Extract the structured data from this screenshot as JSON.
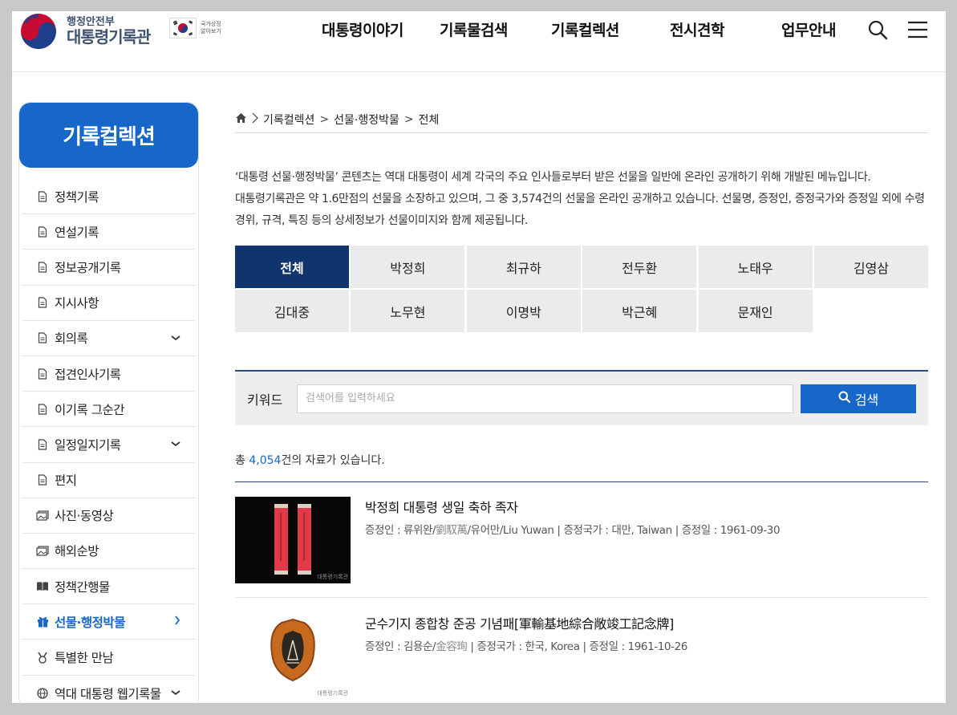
{
  "header": {
    "logo_top": "행정안전부",
    "logo_main": "대통령기록관",
    "flag_text": "국가상징 알아보기",
    "nav": [
      "대통령이야기",
      "기록물검색",
      "기록컬렉션",
      "전시견학",
      "업무안내"
    ]
  },
  "sidebar": {
    "title": "기록컬렉션",
    "items": [
      {
        "label": "정책기록",
        "icon": "document-icon",
        "has_sub": false
      },
      {
        "label": "연설기록",
        "icon": "document-icon",
        "has_sub": false
      },
      {
        "label": "정보공개기록",
        "icon": "document-icon",
        "has_sub": false
      },
      {
        "label": "지시사항",
        "icon": "document-icon",
        "has_sub": false
      },
      {
        "label": "회의록",
        "icon": "document-icon",
        "has_sub": true
      },
      {
        "label": "접견인사기록",
        "icon": "document-icon",
        "has_sub": false
      },
      {
        "label": "이기록 그순간",
        "icon": "document-icon",
        "has_sub": false
      },
      {
        "label": "일정일지기록",
        "icon": "document-icon",
        "has_sub": true
      },
      {
        "label": "편지",
        "icon": "document-icon",
        "has_sub": false
      },
      {
        "label": "사진·동영상",
        "icon": "photo-icon",
        "has_sub": false
      },
      {
        "label": "해외순방",
        "icon": "photo-icon",
        "has_sub": false
      },
      {
        "label": "정책간행물",
        "icon": "book-icon",
        "has_sub": false
      },
      {
        "label": "선물·행정박물",
        "icon": "gift-icon",
        "has_sub": true,
        "active": true
      },
      {
        "label": "특별한 만남",
        "icon": "medal-icon",
        "has_sub": false
      },
      {
        "label": "역대 대통령 웹기록물",
        "icon": "globe-icon",
        "has_sub": true
      }
    ]
  },
  "breadcrumb": [
    "기록컬렉션",
    "선물·행정박물",
    "전체"
  ],
  "breadcrumb_sep": ">",
  "intro": "‘대통령 선물·행정박물’ 콘텐츠는 역대 대통령이 세계 각국의 주요 인사들로부터 받은 선물을 일반에 온라인 공개하기 위해 개발된 메뉴입니다. 대통령기록관은 약 1.6만점의 선물을 소장하고 있으며, 그 중 3,574건의 선물을 온라인 공개하고 있습니다. 선물명, 증정인, 증정국가와 증정일 외에 수령 경위, 규격, 특징 등의 상세정보가 선물이미지와 함께 제공됩니다.",
  "tabs": [
    "전체",
    "박정희",
    "최규하",
    "전두환",
    "노태우",
    "김영삼",
    "김대중",
    "노무현",
    "이명박",
    "박근혜",
    "문재인"
  ],
  "search": {
    "label": "키워드",
    "placeholder": "검색어를 입력하세요",
    "button": "검색"
  },
  "result": {
    "prefix": "총 ",
    "count": "4,054",
    "suffix": "건의 자료가 있습니다."
  },
  "items": [
    {
      "title": "박정희 대통령 생일 축하 족자",
      "donor_label": "증정인 : ",
      "donor": "류위완/",
      "donor_hanja": "劉馭萬",
      "donor_rest": "/유어만/Liu Yuwan",
      "country_label": " | 증정국가 : ",
      "country": "대만, Taiwan",
      "date_label": " | 증정일 : ",
      "date": "1961-09-30",
      "watermark": "대통령기록관"
    },
    {
      "title": "군수기지 종합창 준공 기념패[軍輸基地綜合敞竣工記念牌]",
      "donor_label": "증정인 : ",
      "donor": "김용순/",
      "donor_hanja": "金容珣",
      "donor_rest": "",
      "country_label": " | 증정국가 : ",
      "country": "한국, Korea",
      "date_label": " | 증정일 : ",
      "date": "1961-10-26",
      "watermark": "대통령기록관"
    }
  ],
  "colors": {
    "primary": "#1667c9",
    "tab_active": "#10356c",
    "logo": "#3f5270"
  }
}
